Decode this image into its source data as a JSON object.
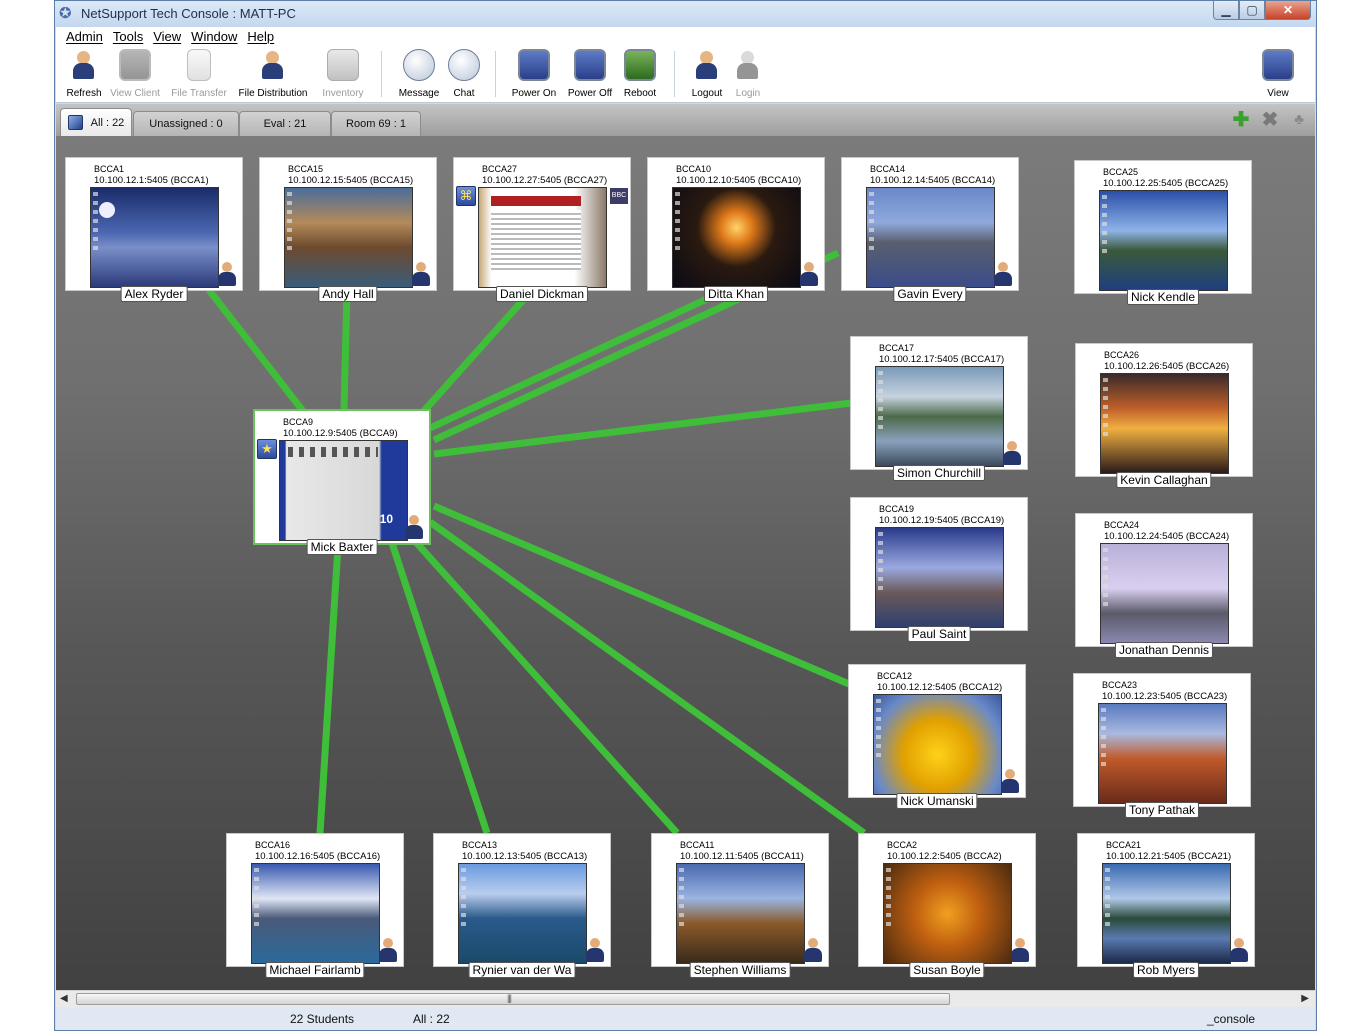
{
  "window": {
    "title": "NetSupport Tech Console : MATT-PC"
  },
  "menu": [
    "Admin",
    "Tools",
    "View",
    "Window",
    "Help"
  ],
  "toolbar": {
    "refresh": "Refresh",
    "view_client": "View Client",
    "file_transfer": "File Transfer",
    "file_distribution": "File Distribution",
    "inventory": "Inventory",
    "message": "Message",
    "chat": "Chat",
    "power_on": "Power On",
    "power_off": "Power Off",
    "reboot": "Reboot",
    "logout": "Logout",
    "login": "Login",
    "view": "View"
  },
  "tabs": [
    {
      "label": "All : 22",
      "active": true
    },
    {
      "label": "Unassigned : 0",
      "active": false
    },
    {
      "label": "Eval : 21",
      "active": false
    },
    {
      "label": "Room 69 : 1",
      "active": false
    }
  ],
  "colors": {
    "link": "#3fbe3a",
    "selected_border": "#6cc15f"
  },
  "clients": [
    {
      "id": "BCCA1",
      "address": "10.100.12.1:5405 (BCCA1)",
      "user": "Alex Ryder"
    },
    {
      "id": "BCCA15",
      "address": "10.100.12.15:5405 (BCCA15)",
      "user": "Andy Hall"
    },
    {
      "id": "BCCA27",
      "address": "10.100.12.27:5405 (BCCA27)",
      "user": "Daniel Dickman"
    },
    {
      "id": "BCCA10",
      "address": "10.100.12.10:5405 (BCCA10)",
      "user": "Ditta Khan"
    },
    {
      "id": "BCCA14",
      "address": "10.100.12.14:5405 (BCCA14)",
      "user": "Gavin Every"
    },
    {
      "id": "BCCA25",
      "address": "10.100.12.25:5405 (BCCA25)",
      "user": "Nick Kendle"
    },
    {
      "id": "BCCA9",
      "address": "10.100.12.9:5405 (BCCA9)",
      "user": "Mick Baxter"
    },
    {
      "id": "BCCA17",
      "address": "10.100.12.17:5405 (BCCA17)",
      "user": "Simon Churchill"
    },
    {
      "id": "BCCA26",
      "address": "10.100.12.26:5405 (BCCA26)",
      "user": "Kevin Callaghan"
    },
    {
      "id": "BCCA19",
      "address": "10.100.12.19:5405 (BCCA19)",
      "user": "Paul Saint"
    },
    {
      "id": "BCCA24",
      "address": "10.100.12.24:5405 (BCCA24)",
      "user": "Jonathan Dennis"
    },
    {
      "id": "BCCA12",
      "address": "10.100.12.12:5405 (BCCA12)",
      "user": "Nick Umanski"
    },
    {
      "id": "BCCA23",
      "address": "10.100.12.23:5405 (BCCA23)",
      "user": "Tony Pathak"
    },
    {
      "id": "BCCA16",
      "address": "10.100.12.16:5405 (BCCA16)",
      "user": "Michael Fairlamb"
    },
    {
      "id": "BCCA13",
      "address": "10.100.12.13:5405 (BCCA13)",
      "user": "Rynier van der Wa"
    },
    {
      "id": "BCCA11",
      "address": "10.100.12.11:5405 (BCCA11)",
      "user": "Stephen Williams"
    },
    {
      "id": "BCCA2",
      "address": "10.100.12.2:5405 (BCCA2)",
      "user": "Susan Boyle"
    },
    {
      "id": "BCCA21",
      "address": "10.100.12.21:5405 (BCCA21)",
      "user": "Rob Myers"
    }
  ],
  "status": {
    "students": "22 Students",
    "group": "All : 22",
    "console": "_console"
  }
}
